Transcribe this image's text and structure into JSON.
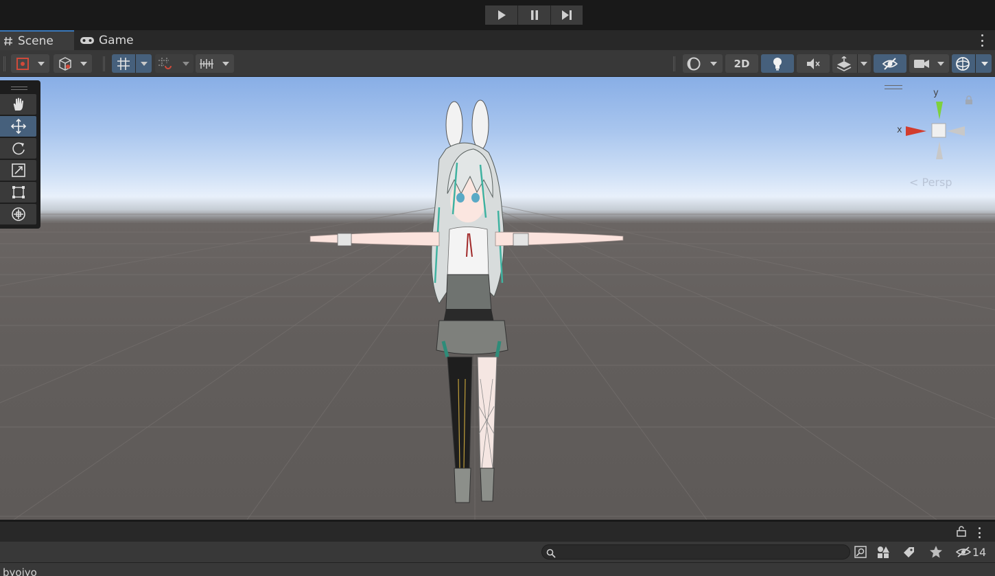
{
  "playbar": {
    "buttons": [
      {
        "name": "play",
        "icon": "play-icon"
      },
      {
        "name": "pause",
        "icon": "pause-icon"
      },
      {
        "name": "step",
        "icon": "step-icon"
      }
    ]
  },
  "tabs": [
    {
      "label": "Scene",
      "icon": "hash-icon",
      "active": true
    },
    {
      "label": "Game",
      "icon": "gamepad-icon",
      "active": false
    }
  ],
  "toolbar": {
    "mode_2d_label": "2D",
    "colors": {
      "active": "#46607c",
      "button": "#464646",
      "bar": "#383838"
    }
  },
  "tools": [
    {
      "name": "hand",
      "icon": "hand-icon",
      "active": false
    },
    {
      "name": "move",
      "icon": "move-icon",
      "active": true
    },
    {
      "name": "rotate",
      "icon": "rotate-icon",
      "active": false
    },
    {
      "name": "scale",
      "icon": "scale-icon",
      "active": false
    },
    {
      "name": "rect",
      "icon": "rect-icon",
      "active": false
    },
    {
      "name": "transform",
      "icon": "transform-icon",
      "active": false
    }
  ],
  "gizmo": {
    "x_label": "x",
    "y_label": "y",
    "projection_label": "< Persp",
    "colors": {
      "x": "#d23c2d",
      "y": "#7ed13c",
      "neutral": "#c8c8c8"
    }
  },
  "hierarchy": {
    "search_placeholder": "",
    "hidden_count": "14",
    "root_item": "byoiyo"
  }
}
